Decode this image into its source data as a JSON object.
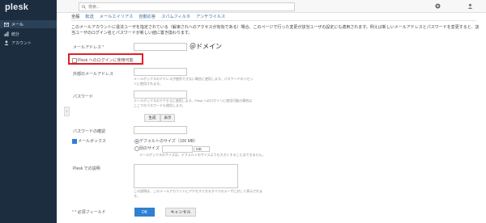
{
  "app": {
    "logo": "plesk"
  },
  "sidebar": {
    "items": [
      {
        "label": "メール"
      },
      {
        "label": "統計"
      },
      {
        "label": "アカウント"
      }
    ]
  },
  "search": {
    "placeholder": "検索..."
  },
  "tabs": [
    "全般",
    "転送",
    "メールエイリアス",
    "自動応答",
    "スパムフィルタ",
    "アンチウイルス"
  ],
  "description": "このメールアカウントに違法ユーザを指定されている（解凍されへのアクセスが有効である）場合、このページで行った変更が該当ユーザの設定にも適用されます。例えば新しいメールアドレスとパスワードを変更すると、該当ユーザのログイン名とパスワードが新しい値に置き換わります。",
  "form": {
    "email_label": "メールアドレス",
    "domain_annotation": "＠ドメイン",
    "plesk_login_label": "Plesk へのログインに使用可能",
    "external_email_label": "外部のメールアドレス",
    "external_email_hint": "メールボックスのアドレスが使用できない場合に使用します。パスワードのリセットに使用されます。",
    "password_label": "パスワード",
    "password_hint": "メールボックスのアクセスに使用します。Plesk へのログインに使用可能の場合はここでのパスワードも使用します。",
    "generate_button": "生成",
    "show_button": "表示",
    "confirm_label": "パスワードの確認",
    "mailbox_label": "メールボックス",
    "default_size_label": "デフォルトのサイズ（100 MB）",
    "another_size_label": "別のサイズ",
    "unit": "MB",
    "mailbox_hint": "メールボックスのサイズは、デフォルトのサイズよりも大きくすることはできません。",
    "description_label": "Plesk での説明",
    "description_hint": "この説明は、このメールアカウントにアクセスできるすべてのユーザに対して表示されます。",
    "required_label": "* 必須フィールド",
    "ok_button": "OK",
    "cancel_button": "キャンセル"
  }
}
